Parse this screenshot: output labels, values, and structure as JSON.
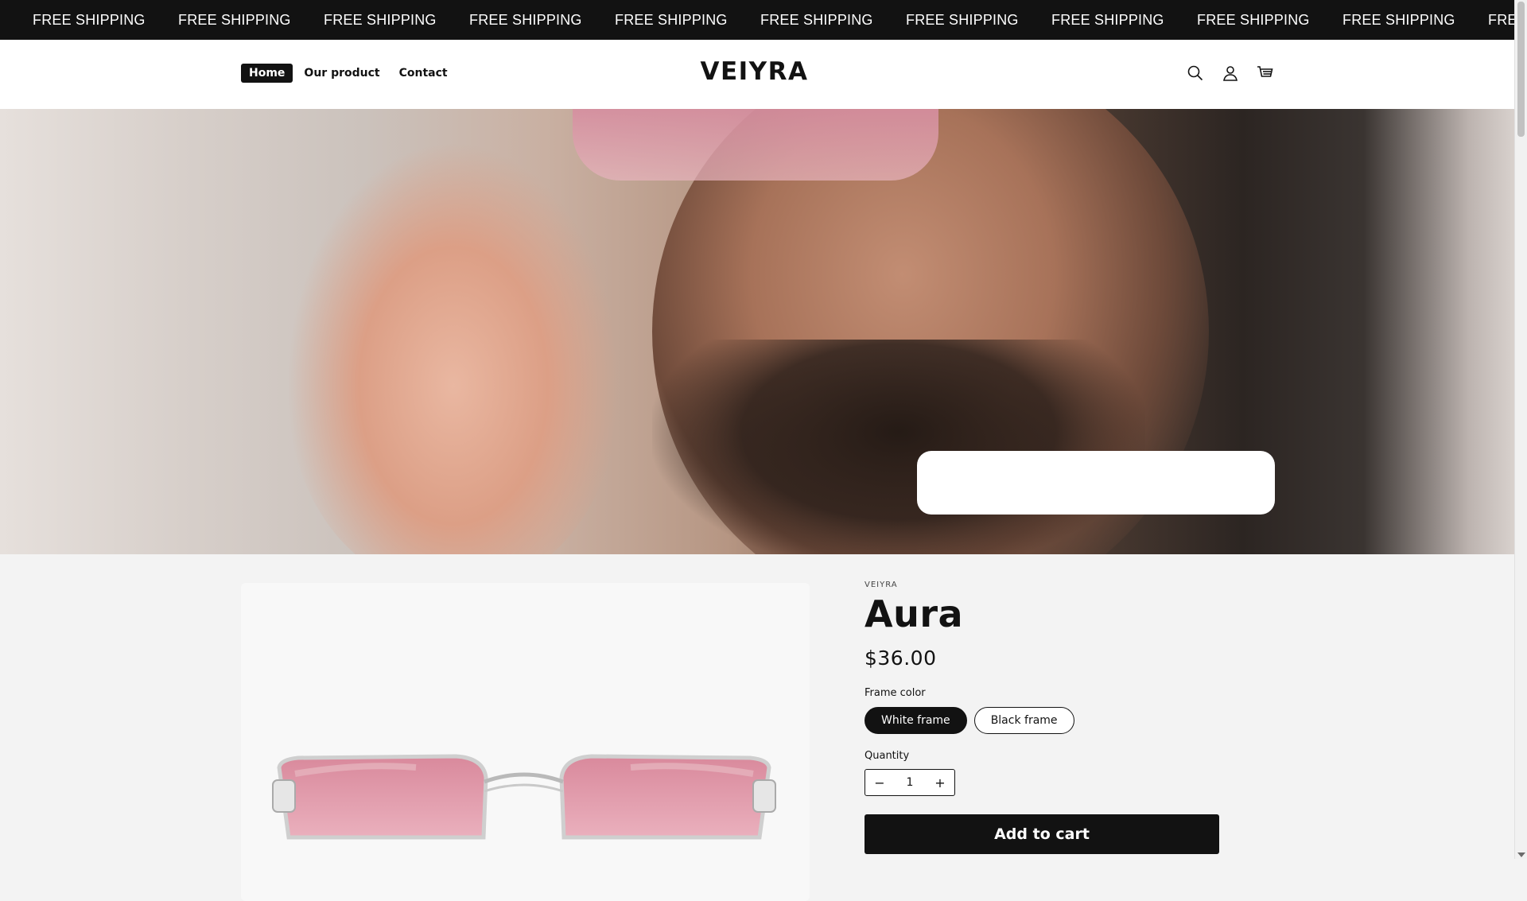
{
  "announcement": {
    "items": [
      "FREE SHIPPING",
      "FREE SHIPPING",
      "FREE SHIPPING",
      "FREE SHIPPING",
      "FREE SHIPPING",
      "FREE SHIPPING",
      "FREE SHIPPING",
      "FREE SHIPPING",
      "FREE SHIPPING",
      "FREE SHIPPING",
      "FREE SHIPPING"
    ]
  },
  "header": {
    "nav": [
      {
        "label": "Home",
        "active": true
      },
      {
        "label": "Our product",
        "active": false
      },
      {
        "label": "Contact",
        "active": false
      }
    ],
    "logo": "VEIYRA",
    "icons": [
      "search-icon",
      "account-icon",
      "cart-icon"
    ]
  },
  "product": {
    "vendor": "VEIYRA",
    "title": "Aura",
    "price": "$36.00",
    "variant_label": "Frame color",
    "variants": [
      {
        "label": "White frame",
        "selected": true
      },
      {
        "label": "Black frame",
        "selected": false
      }
    ],
    "quantity_label": "Quantity",
    "quantity": "1",
    "decrease_symbol": "−",
    "increase_symbol": "+",
    "add_to_cart": "Add to cart"
  },
  "colors": {
    "brand_dark": "#121212",
    "lens_pink": "#e8a4b4"
  }
}
